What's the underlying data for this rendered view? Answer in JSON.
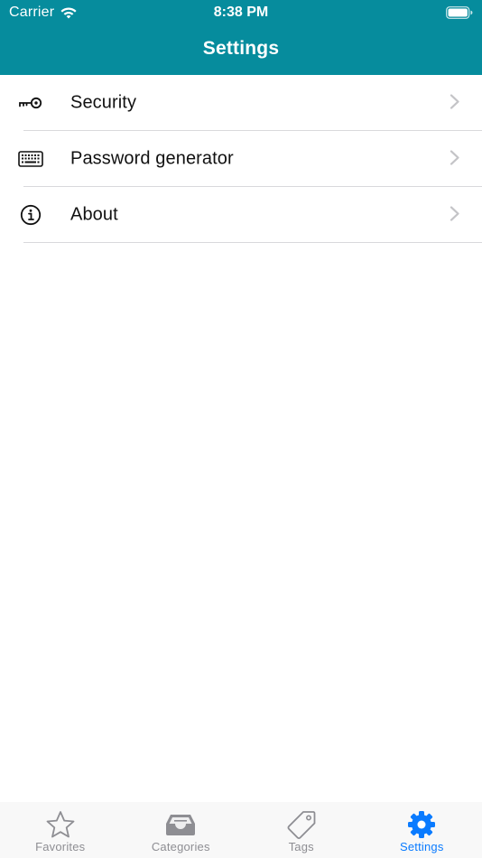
{
  "status_bar": {
    "carrier": "Carrier",
    "time": "8:38 PM"
  },
  "nav": {
    "title": "Settings"
  },
  "settings_items": [
    {
      "label": "Security",
      "icon": "key-icon"
    },
    {
      "label": "Password generator",
      "icon": "keyboard-icon"
    },
    {
      "label": "About",
      "icon": "info-icon"
    }
  ],
  "tabbar": {
    "tabs": [
      {
        "label": "Favorites",
        "icon": "star-icon",
        "active": false
      },
      {
        "label": "Categories",
        "icon": "tray-icon",
        "active": false
      },
      {
        "label": "Tags",
        "icon": "tag-icon",
        "active": false
      },
      {
        "label": "Settings",
        "icon": "gear-icon",
        "active": true
      }
    ]
  },
  "colors": {
    "header": "#068c9d",
    "active_tab": "#0a7bff",
    "inactive_tab": "#8e8e93"
  }
}
